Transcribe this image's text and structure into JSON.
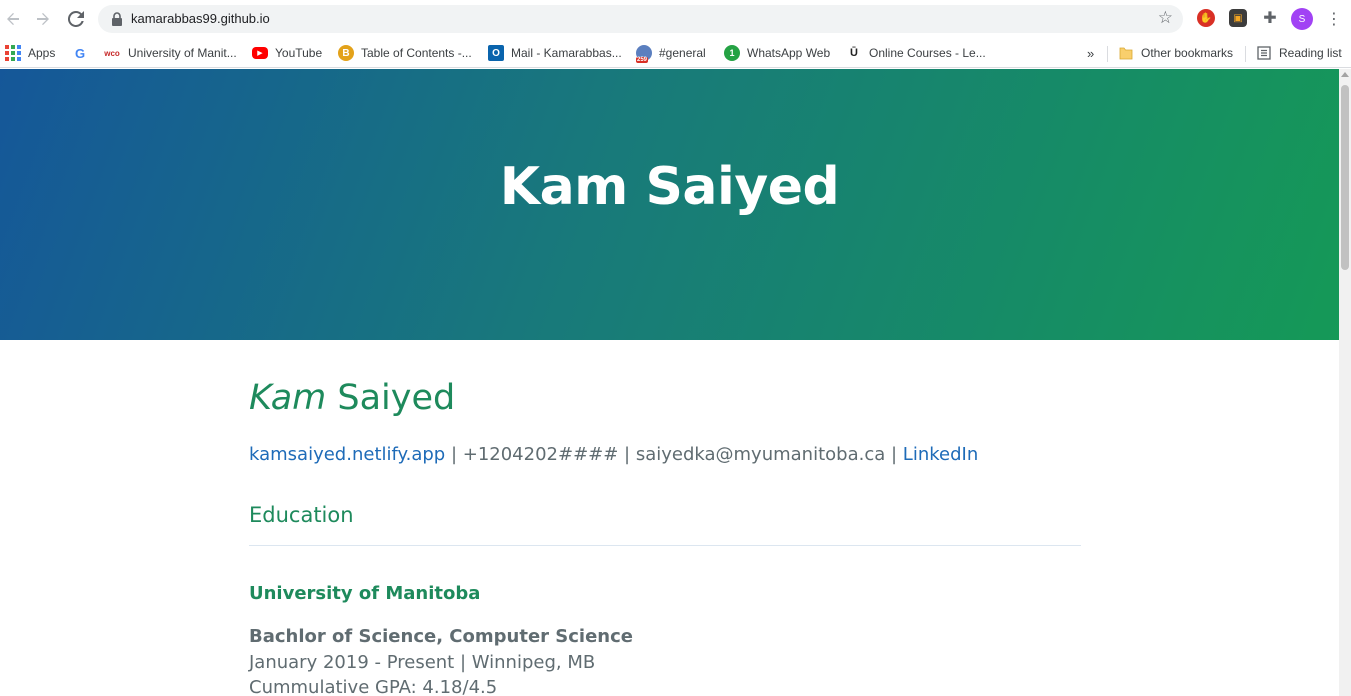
{
  "browser": {
    "url": "kamarabbas99.github.io",
    "avatar_letter": "S"
  },
  "bookmarks": {
    "items": [
      {
        "label": "Apps",
        "icon": "apps-grid-icon"
      },
      {
        "label": "",
        "icon": "google-icon"
      },
      {
        "label": "University of Manit...",
        "icon": "wco-icon"
      },
      {
        "label": "YouTube",
        "icon": "youtube-icon"
      },
      {
        "label": "Table of Contents -...",
        "icon": "coin-icon"
      },
      {
        "label": "Mail - Kamarabbas...",
        "icon": "outlook-icon"
      },
      {
        "label": "#general",
        "icon": "slack-badge-icon",
        "badge": "259"
      },
      {
        "label": "WhatsApp Web",
        "icon": "whatsapp-icon",
        "badge": "1"
      },
      {
        "label": "Online Courses - Le...",
        "icon": "udemy-icon"
      }
    ],
    "overflow": "»",
    "other": "Other bookmarks",
    "reading_list": "Reading list"
  },
  "page": {
    "hero_title": "Kam Saiyed",
    "name_first": "Kam",
    "name_last": " Saiyed",
    "contact": {
      "website": "kamsaiyed.netlify.app",
      "sep": " | ",
      "phone": "+1204202####",
      "email": "saiyedka@myumanitoba.ca",
      "linkedin": "LinkedIn"
    },
    "education": {
      "heading": "Education",
      "org": "University of Manitoba",
      "degree": "Bachlor of Science, Computer Science",
      "dates": "January 2019 - Present | Winnipeg, MB",
      "gpa": "Cummulative GPA: 4.18/4.5"
    }
  },
  "colors": {
    "hero_start": "#155799",
    "hero_end": "#159957",
    "accent_green": "#1e8a5c",
    "link_blue": "#1e6bb8",
    "body_text": "#606c71"
  }
}
